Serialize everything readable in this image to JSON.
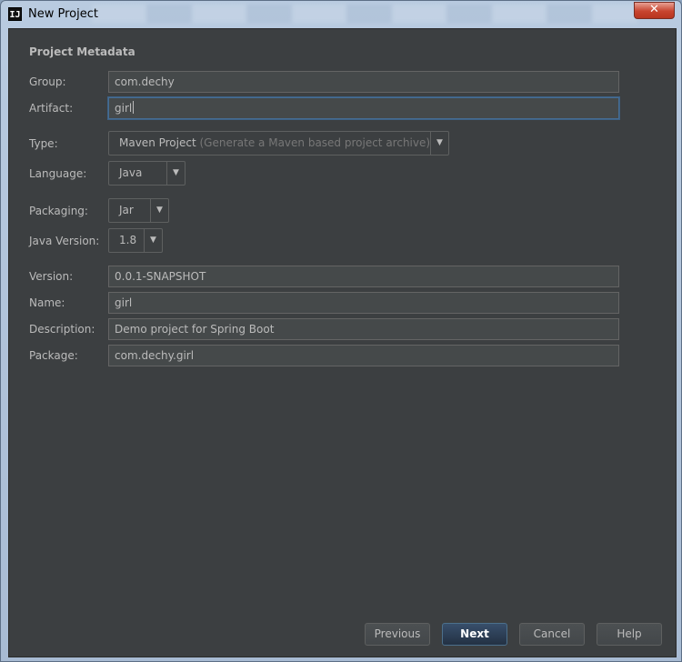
{
  "window": {
    "title": "New Project",
    "app_icon": "intellij-icon",
    "close_glyph": "✕"
  },
  "metadata": {
    "section_title": "Project Metadata",
    "group": {
      "label": "Group:",
      "value": "com.dechy"
    },
    "artifact": {
      "label": "Artifact:",
      "value": "girl"
    },
    "type": {
      "label": "Type:",
      "value": "Maven Project",
      "hint": "(Generate a Maven based project archive)"
    },
    "language": {
      "label": "Language:",
      "value": "Java"
    },
    "packaging": {
      "label": "Packaging:",
      "value": "Jar"
    },
    "java_version": {
      "label": "Java Version:",
      "value": "1.8"
    },
    "version": {
      "label": "Version:",
      "value": "0.0.1-SNAPSHOT"
    },
    "name": {
      "label": "Name:",
      "value": "girl"
    },
    "description": {
      "label": "Description:",
      "value": "Demo project for Spring Boot"
    },
    "package": {
      "label": "Package:",
      "value": "com.dechy.girl"
    }
  },
  "buttons": {
    "previous": "Previous",
    "next": "Next",
    "cancel": "Cancel",
    "help": "Help"
  },
  "colors": {
    "background": "#3c3f41",
    "field_background": "#45494a",
    "focus_border": "#466d94",
    "default_button": "#2f4359"
  }
}
